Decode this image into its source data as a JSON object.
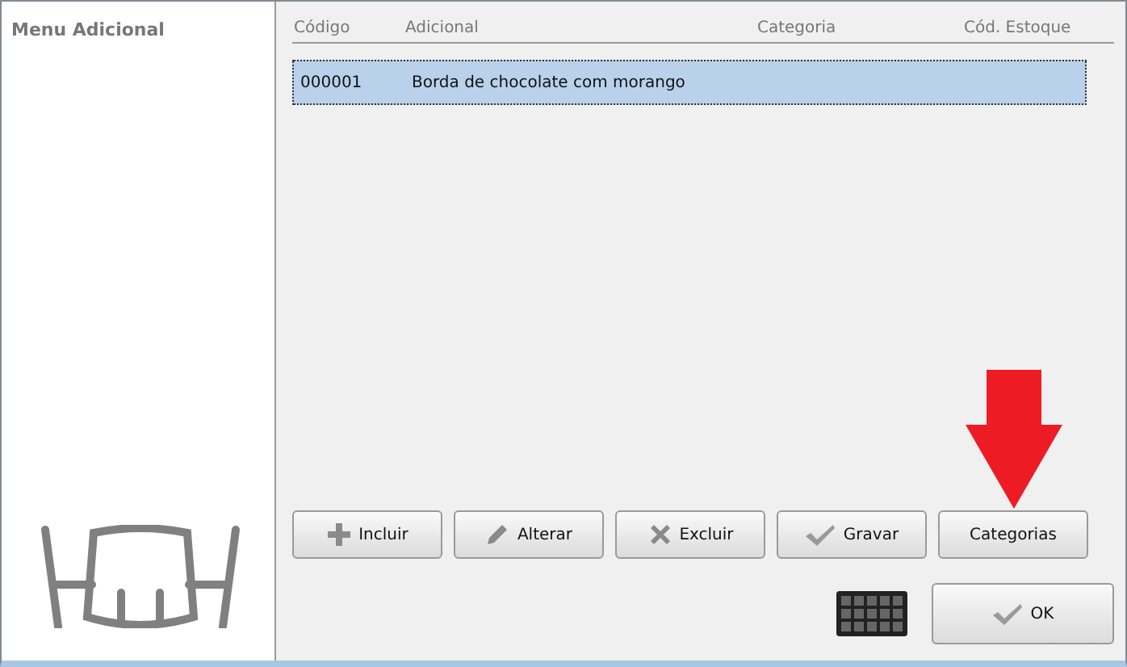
{
  "sidebar": {
    "title": "Menu Adicional"
  },
  "table": {
    "columns": [
      "Código",
      "Adicional",
      "Categoria",
      "Cód. Estoque"
    ],
    "rows": [
      {
        "cells": [
          "000001",
          "Borda de chocolate com morango",
          "",
          ""
        ],
        "selected": true
      }
    ]
  },
  "buttons": [
    {
      "label": "Incluir",
      "kind": "add"
    },
    {
      "label": "Alterar",
      "kind": "edit"
    },
    {
      "label": "Excluir",
      "kind": "delete"
    },
    {
      "label": "Gravar",
      "kind": "save"
    },
    {
      "label": "Categorias",
      "kind": "plain"
    }
  ],
  "ok_button": {
    "label": "OK"
  }
}
